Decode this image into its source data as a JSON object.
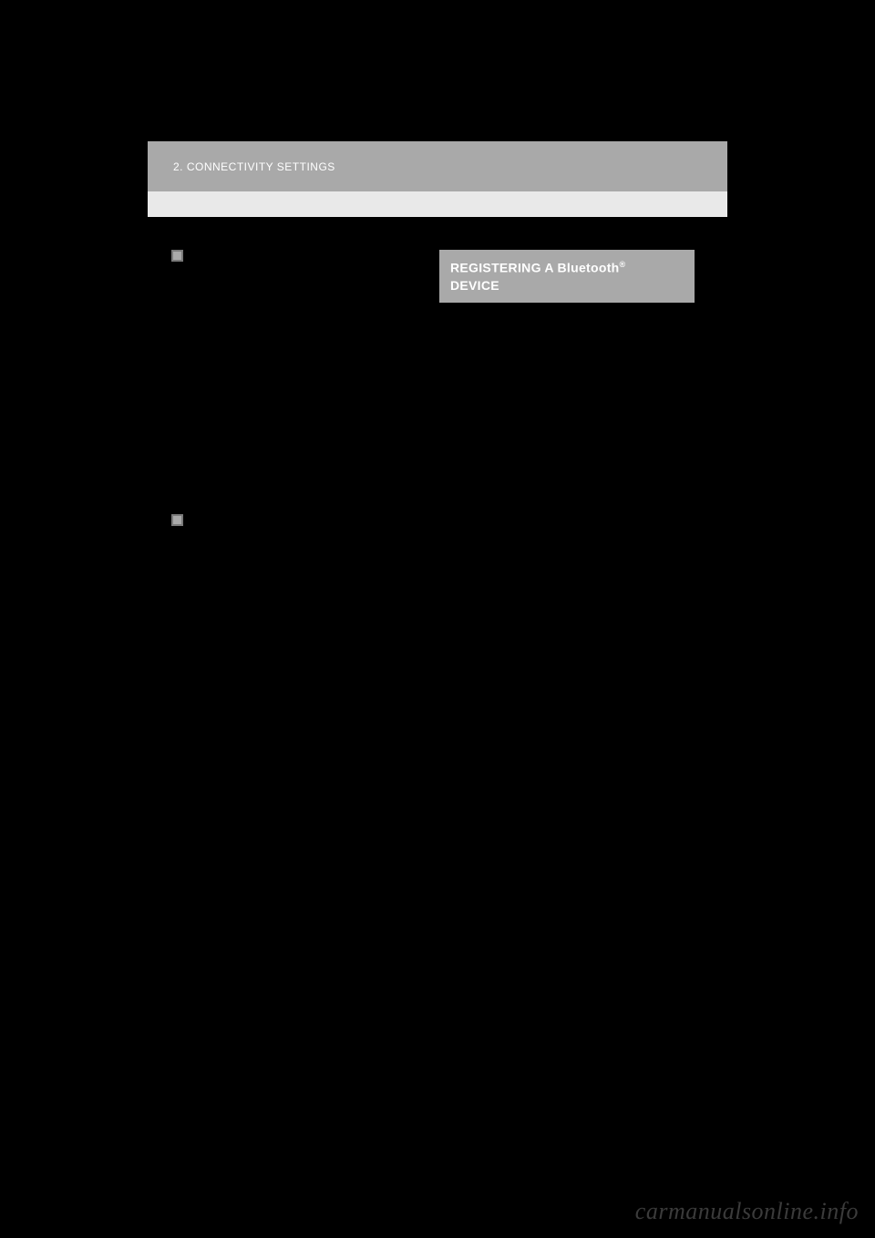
{
  "header": {
    "breadcrumb": "2.  CONNECTIVITY SETTINGS"
  },
  "section": {
    "title_part1": "REGISTERING A Bluetooth",
    "title_suffix": "®",
    "title_part2": "DEVICE"
  },
  "watermark": "carmanualsonline.info"
}
